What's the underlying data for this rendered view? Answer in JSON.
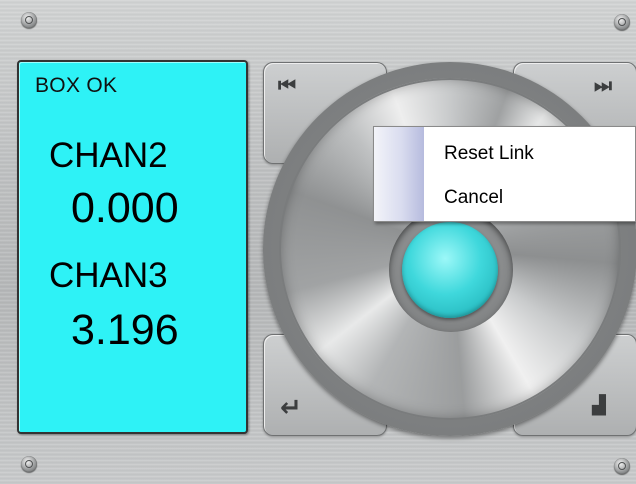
{
  "lcd": {
    "status": "BOX OK",
    "channels": [
      {
        "label": "CHAN2",
        "value": "0.000"
      },
      {
        "label": "CHAN3",
        "value": "3.196"
      }
    ]
  },
  "controls": {
    "prev_icon": "skip-back-icon",
    "next_icon": "skip-forward-icon",
    "return_icon": "return-arrow-icon",
    "levels_icon": "levels-icon",
    "prev_glyph": "⏮",
    "next_glyph": "⏭",
    "return_glyph": "↵",
    "levels_glyph": "▟"
  },
  "context_menu": {
    "items": [
      "Reset Link",
      "Cancel"
    ]
  },
  "colors": {
    "lcd_background": "#2ef2f6",
    "knob": "#3fd8dc"
  }
}
